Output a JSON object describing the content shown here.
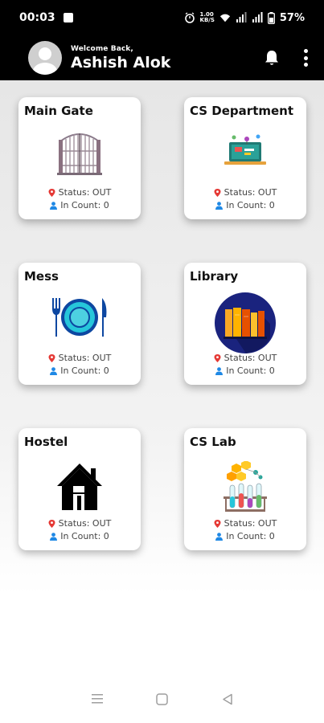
{
  "status_bar": {
    "time": "00:03",
    "net_speed_top": "1.00",
    "net_speed_bottom": "KB/S",
    "battery": "57%"
  },
  "header": {
    "greeting": "Welcome Back,",
    "user_name": "Ashish Alok"
  },
  "locations": [
    {
      "name": "Main Gate",
      "status": "Status: OUT",
      "count": "In Count: 0",
      "icon": "gate-icon"
    },
    {
      "name": "CS Department",
      "status": "Status: OUT",
      "count": "In Count: 0",
      "icon": "laptop-icon"
    },
    {
      "name": "Mess",
      "status": "Status: OUT",
      "count": "In Count: 0",
      "icon": "plate-cutlery-icon"
    },
    {
      "name": "Library",
      "status": "Status: OUT",
      "count": "In Count: 0",
      "icon": "books-icon"
    },
    {
      "name": "Hostel",
      "status": "Status: OUT",
      "count": "In Count: 0",
      "icon": "house-icon"
    },
    {
      "name": "CS Lab",
      "status": "Status: OUT",
      "count": "In Count: 0",
      "icon": "lab-flask-icon"
    }
  ],
  "colors": {
    "header_bg": "#000000",
    "pin_red": "#e53935",
    "person_blue": "#1e88e5"
  }
}
